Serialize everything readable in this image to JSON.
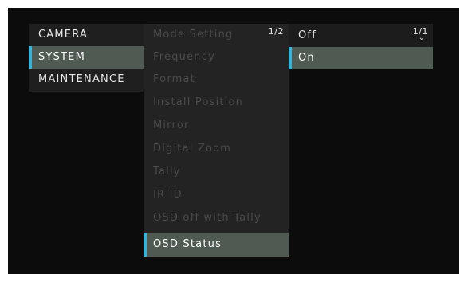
{
  "menu": {
    "categories": [
      {
        "label": "CAMERA",
        "selected": false
      },
      {
        "label": "SYSTEM",
        "selected": true
      },
      {
        "label": "MAINTENANCE",
        "selected": false
      }
    ]
  },
  "system_menu": {
    "page_indicator": "1/2",
    "items": [
      {
        "label": "Mode Setting",
        "enabled": false
      },
      {
        "label": "Frequency",
        "enabled": false
      },
      {
        "label": "Format",
        "enabled": false
      },
      {
        "label": "Install Position",
        "enabled": false
      },
      {
        "label": "Mirror",
        "enabled": false
      },
      {
        "label": "Digital Zoom",
        "enabled": false
      },
      {
        "label": "Tally",
        "enabled": false
      },
      {
        "label": "IR ID",
        "enabled": false
      },
      {
        "label": "OSD off with Tally",
        "enabled": false
      },
      {
        "label": "OSD Status",
        "enabled": true,
        "selected": true
      }
    ]
  },
  "options_menu": {
    "page_indicator": "1/1",
    "scroll_icon": "chevron-down-icon",
    "options": [
      {
        "label": "Off",
        "selected": false
      },
      {
        "label": "On",
        "selected": true
      }
    ]
  },
  "colors": {
    "highlight": "#4f5a52",
    "accent": "#37b4d8",
    "background": "#0c0c0c"
  }
}
